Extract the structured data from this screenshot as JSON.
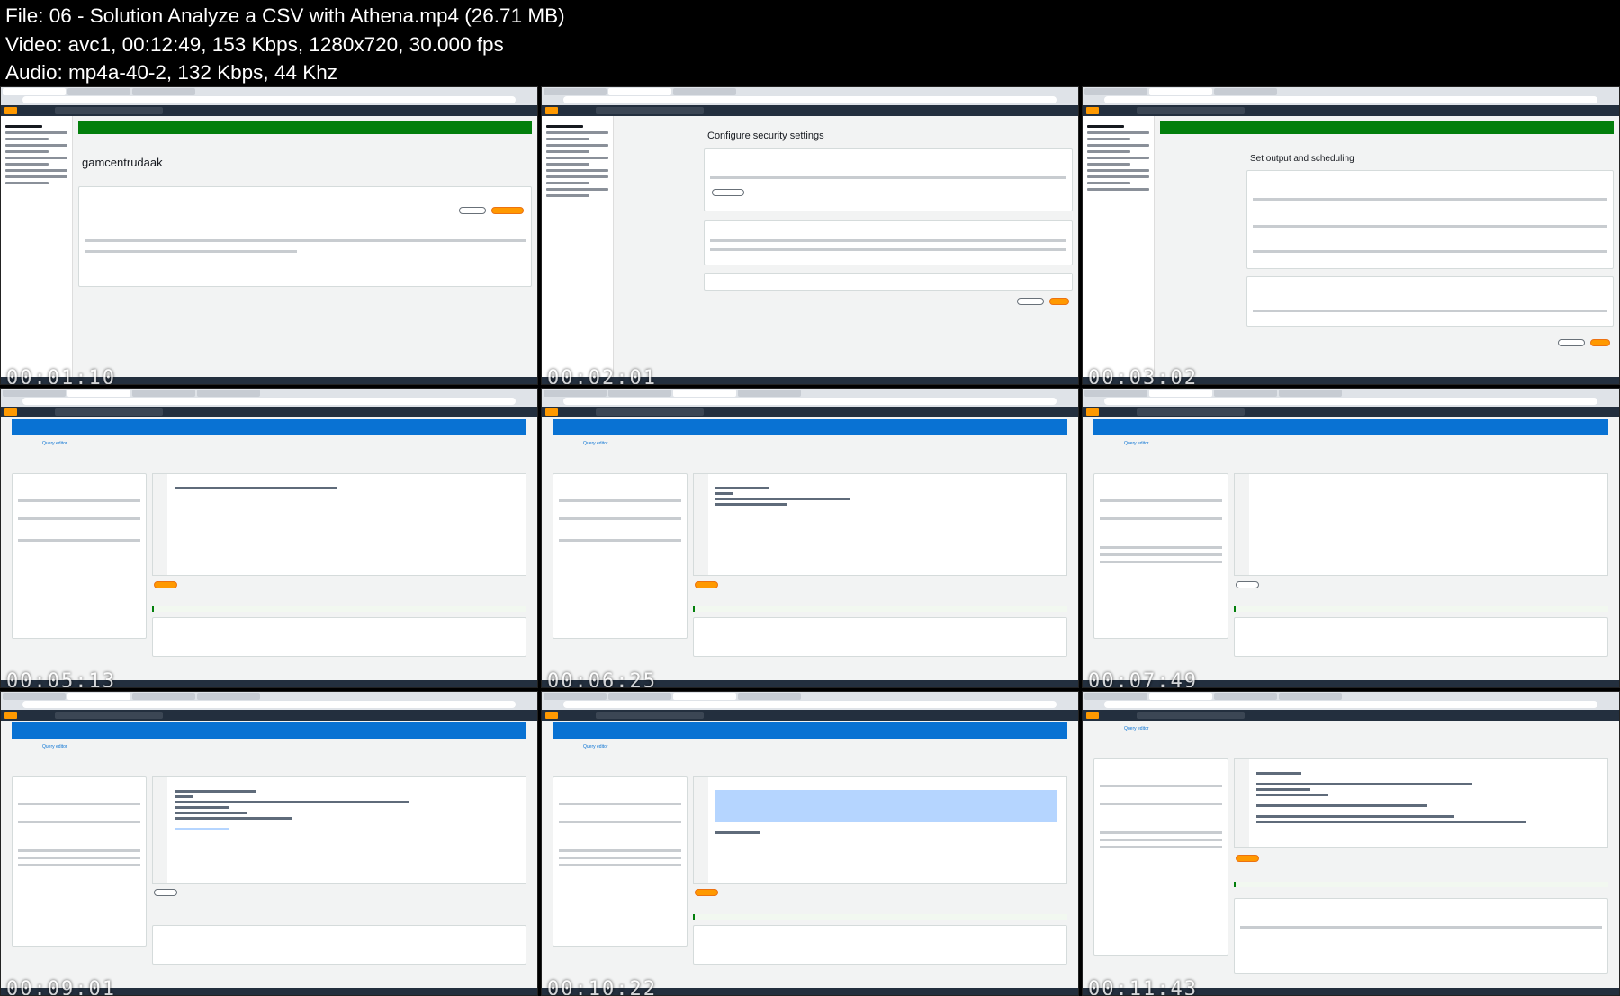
{
  "media_info": {
    "file_line": "File: 06 - Solution Analyze a CSV with Athena.mp4 (26.71 MB)",
    "video_line": "Video: avc1, 00:12:49, 153 Kbps, 1280x720, 30.000 fps",
    "audio_line": "Audio: mp4a-40-2, 132 Kbps, 44 Khz"
  },
  "thumbnails": [
    {
      "title": "gamcentrudaak",
      "screen": "Amazon S3 bucket objects"
    },
    {
      "title": "Configure security settings",
      "screen": "AWS Glue crawler"
    },
    {
      "title": "Set output and scheduling",
      "screen": "AWS Glue crawler"
    },
    {
      "title": "Query editor",
      "screen": "Athena query editor"
    },
    {
      "title": "Query editor",
      "screen": "Athena query editor"
    },
    {
      "title": "Query editor",
      "screen": "Athena query editor"
    },
    {
      "title": "Query editor",
      "screen": "Athena query editor"
    },
    {
      "title": "Query editor",
      "screen": "Athena query editor"
    },
    {
      "title": "Query editor",
      "screen": "Athena query editor"
    }
  ],
  "colors": {
    "aws_nav": "#232f3e",
    "aws_orange": "#ff9900",
    "success_green": "#037f0c",
    "info_blue": "#0972d3"
  }
}
